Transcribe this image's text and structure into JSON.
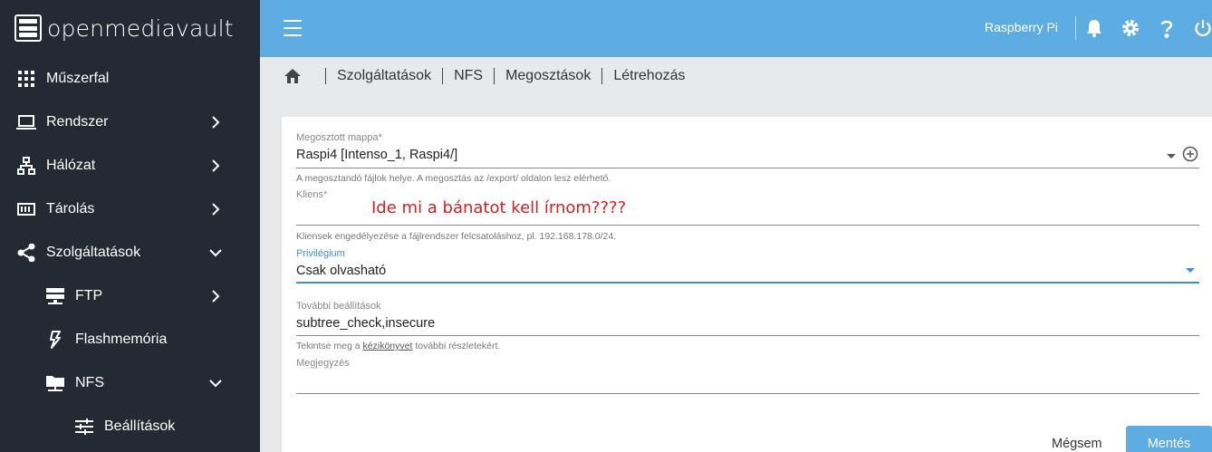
{
  "app": {
    "logo_text": "openmediavault"
  },
  "sidebar": {
    "items": [
      {
        "label": "Műszerfal",
        "icon": "dashboard-grid-icon"
      },
      {
        "label": "Rendszer",
        "icon": "laptop-icon",
        "chevron": "right"
      },
      {
        "label": "Hálózat",
        "icon": "network-icon",
        "chevron": "right"
      },
      {
        "label": "Tárolás",
        "icon": "storage-icon",
        "chevron": "right"
      },
      {
        "label": "Szolgáltatások",
        "icon": "share-icon",
        "chevron": "down"
      },
      {
        "label": "FTP",
        "icon": "server-icon",
        "chevron": "right"
      },
      {
        "label": "Flashmemória",
        "icon": "flash-icon"
      },
      {
        "label": "NFS",
        "icon": "folder-network-icon",
        "chevron": "down"
      },
      {
        "label": "Beállítások",
        "icon": "tune-icon"
      }
    ]
  },
  "topbar": {
    "host": "Raspberry Pi"
  },
  "breadcrumb": [
    "Szolgáltatások",
    "NFS",
    "Megosztások",
    "Létrehozás"
  ],
  "form": {
    "shared_folder": {
      "label": "Megosztott mappa*",
      "value": "Raspi4 [Intenso_1, Raspi4/]",
      "hint": "A megosztandó fájlok helye. A megosztás az /export/ oldalon lesz elérhető."
    },
    "client": {
      "label": "Kliens*",
      "value": "",
      "hint": "Kliensek engedélyezése a fájlrendszer felcsatoláshoz, pl. 192.168.178.0/24."
    },
    "annotation": "Ide mi a bánatot kell írnom????",
    "privilege": {
      "label": "Privilégium",
      "value": "Csak olvasható"
    },
    "extra": {
      "label": "További beállítások",
      "value": "subtree_check,insecure",
      "hint_before": "Tekintse meg a ",
      "hint_link": "kézikönyvet",
      "hint_after": " további részletekért."
    },
    "comment": {
      "label": "Megjegyzés",
      "value": ""
    }
  },
  "buttons": {
    "cancel": "Mégsem",
    "save": "Mentés"
  },
  "colors": {
    "sidebar": "#242a33",
    "topbar": "#5dade2",
    "accent": "#3d8fd6",
    "annotation": "#d42020"
  }
}
